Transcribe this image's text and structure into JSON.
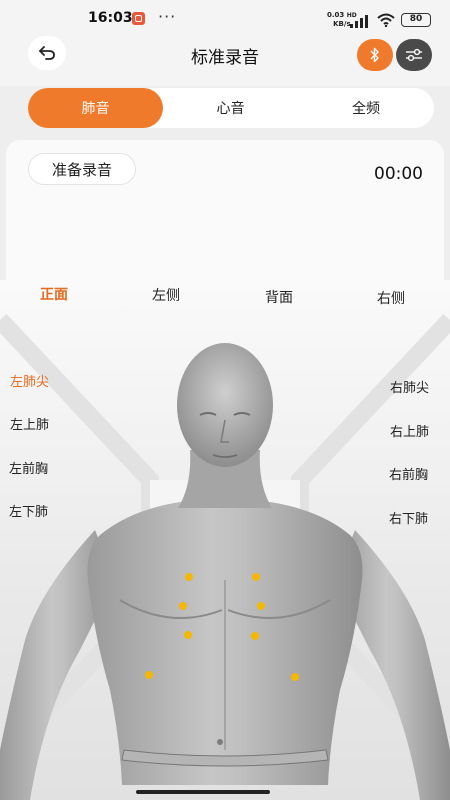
{
  "status": {
    "time": "16:03",
    "dots": "···",
    "speed_top": "0.03",
    "speed_bottom": "KB/s",
    "network": "HD",
    "battery": "80"
  },
  "header": {
    "title": "标准录音"
  },
  "tabs": [
    {
      "label": "肺音",
      "active": true
    },
    {
      "label": "心音",
      "active": false
    },
    {
      "label": "全频",
      "active": false
    }
  ],
  "recording": {
    "ready_label": "准备录音",
    "timer": "00:00"
  },
  "views": [
    {
      "label": "正面",
      "active": true
    },
    {
      "label": "左侧",
      "active": false
    },
    {
      "label": "背面",
      "active": false
    },
    {
      "label": "右侧",
      "active": false
    }
  ],
  "left_points": [
    {
      "label": "左肺尖",
      "active": true
    },
    {
      "label": "左上肺",
      "active": false
    },
    {
      "label": "左前胸",
      "active": false
    },
    {
      "label": "左下肺",
      "active": false
    }
  ],
  "right_points": [
    {
      "label": "右肺尖",
      "active": false
    },
    {
      "label": "右上肺",
      "active": false
    },
    {
      "label": "右前胸",
      "active": false
    },
    {
      "label": "右下肺",
      "active": false
    }
  ],
  "colors": {
    "accent": "#f07a2c",
    "accent_text": "#e56b1f",
    "point": "#f5b700"
  }
}
